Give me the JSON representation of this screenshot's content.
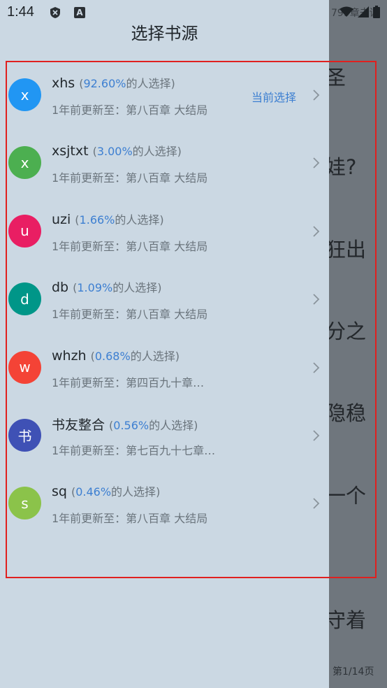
{
  "status_bar": {
    "time": "1:44",
    "reader_progress": "799章未读"
  },
  "reader": {
    "lines": [
      "圣",
      "娃?",
      "狂出",
      "分之",
      "隐稳",
      "一个",
      "守着"
    ],
    "page_indicator": "第1/14页"
  },
  "drawer": {
    "title": "选择书源",
    "sources": [
      {
        "avatar": "x",
        "avatar_color": "#2196f3",
        "name": "xhs",
        "pct": "92.60%",
        "pct_suffix": "的人选择",
        "update": "1年前更新至：第八百章 大结局",
        "current": "当前选择"
      },
      {
        "avatar": "x",
        "avatar_color": "#4caf50",
        "name": "xsjtxt",
        "pct": "3.00%",
        "pct_suffix": "的人选择",
        "update": "1年前更新至：第八百章 大结局",
        "current": ""
      },
      {
        "avatar": "u",
        "avatar_color": "#e91e63",
        "name": "uzi",
        "pct": "1.66%",
        "pct_suffix": "的人选择",
        "update": "1年前更新至：第八百章 大结局",
        "current": ""
      },
      {
        "avatar": "d",
        "avatar_color": "#009688",
        "name": "db",
        "pct": "1.09%",
        "pct_suffix": "的人选择",
        "update": "1年前更新至：第八百章 大结局",
        "current": ""
      },
      {
        "avatar": "w",
        "avatar_color": "#f44336",
        "name": "whzh",
        "pct": "0.68%",
        "pct_suffix": "的人选择",
        "update": "1年前更新至：第四百九十章…",
        "current": ""
      },
      {
        "avatar": "书",
        "avatar_color": "#3f51b5",
        "name": "书友整合",
        "pct": "0.56%",
        "pct_suffix": "的人选择",
        "update": "1年前更新至：第七百九十七章…",
        "current": ""
      },
      {
        "avatar": "s",
        "avatar_color": "#8bc34a",
        "name": "sq",
        "pct": "0.46%",
        "pct_suffix": "的人选择",
        "update": "1年前更新至：第八百章 大结局",
        "current": ""
      }
    ]
  }
}
